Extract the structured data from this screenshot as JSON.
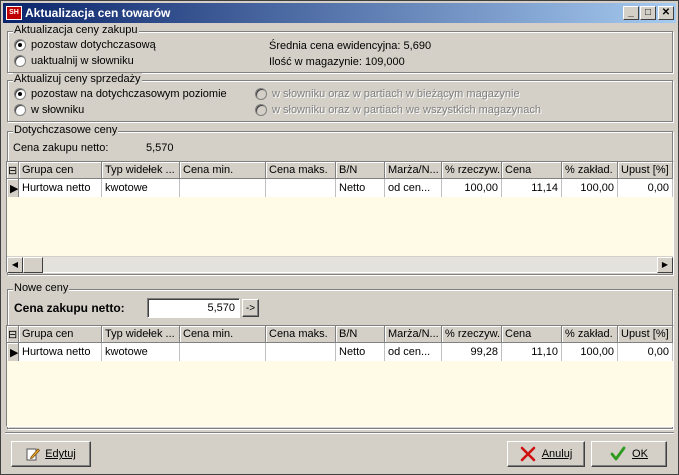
{
  "window": {
    "title": "Aktualizacja cen towarów",
    "app_icon": "SH"
  },
  "purchase": {
    "legend": "Aktualizacja ceny zakupu",
    "opt1": "pozostaw dotychczasową",
    "opt2": "uaktualnij w słowniku",
    "avg_price": "Średnia cena ewidencyjna: 5,690",
    "quantity": "Ilość w magazynie: 109,000"
  },
  "sales": {
    "legend": "Aktualizuj ceny sprzedaży",
    "opt1": "pozostaw na dotychczasowym poziomie",
    "opt2": "w słowniku",
    "opt3": "w słowniku oraz w partiach w bieżącym magazynie",
    "opt4": "w słowniku oraz w partiach we wszystkich magazynach"
  },
  "current": {
    "legend": "Dotychczasowe ceny",
    "net_label": "Cena zakupu netto:",
    "net_value": "5,570",
    "columns": [
      "Grupa cen",
      "Typ widełek ...",
      "Cena min.",
      "Cena maks.",
      "B/N",
      "Marża/N...",
      "% rzeczyw.",
      "Cena",
      "% zakład.",
      "Upust [%]"
    ],
    "row": [
      "Hurtowa netto",
      "kwotowe",
      "",
      "",
      "Netto",
      "od cen...",
      "100,00",
      "11,14",
      "100,00",
      "0,00"
    ]
  },
  "new": {
    "legend": "Nowe ceny",
    "net_label": "Cena zakupu netto:",
    "net_value": "5,570",
    "apply_label": "->",
    "columns": [
      "Grupa cen",
      "Typ widełek ...",
      "Cena min.",
      "Cena maks.",
      "B/N",
      "Marża/N...",
      "% rzeczyw.",
      "Cena",
      "% zakład.",
      "Upust [%]"
    ],
    "row": [
      "Hurtowa netto",
      "kwotowe",
      "",
      "",
      "Netto",
      "od cen...",
      "99,28",
      "11,10",
      "100,00",
      "0,00"
    ]
  },
  "buttons": {
    "edit": "Edytuj",
    "cancel": "Anuluj",
    "ok": "OK"
  },
  "colors": {
    "title_start": "#0a246a",
    "title_end": "#a6caf0",
    "grid_bg": "#fffbe6",
    "row_border": "#c00000",
    "ok_check": "#2e9a1e",
    "cancel_x": "#d01010"
  }
}
